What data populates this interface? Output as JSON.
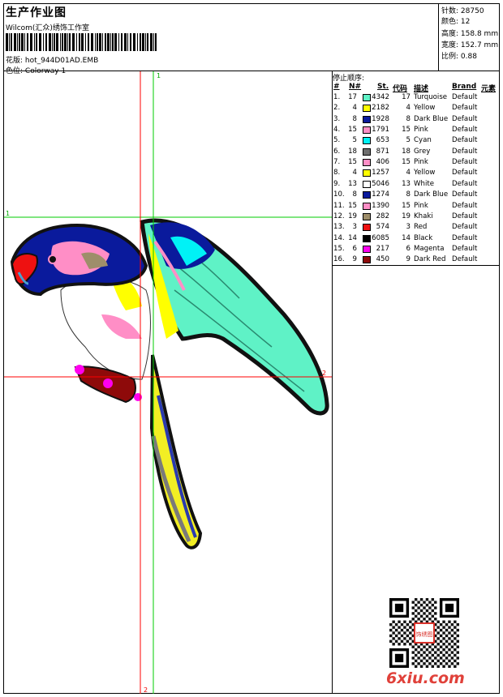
{
  "header": {
    "title": "生产作业图",
    "studio": "Wilcom(汇众)绣饰工作室",
    "design_label": "花版:",
    "design_file": "hot_944D01AD.EMB",
    "colorway_label": "色位:",
    "colorway": "Colorway 1"
  },
  "stats": [
    {
      "label": "针数:",
      "value": "28750"
    },
    {
      "label": "颜色:",
      "value": "12"
    },
    {
      "label": "高度:",
      "value": "158.8 mm"
    },
    {
      "label": "宽度:",
      "value": "152.7 mm"
    },
    {
      "label": "比例:",
      "value": "0.88"
    }
  ],
  "sequence": {
    "title": "停止顺序:",
    "columns": [
      "#",
      "N#",
      "St.",
      "代码",
      "描述",
      "Brand",
      "元素"
    ],
    "rows": [
      {
        "idx": "1.",
        "n": "17",
        "color": "#5ff2c6",
        "st": "4342",
        "code": "17",
        "desc": "Turquoise",
        "brand": "Default"
      },
      {
        "idx": "2.",
        "n": "4",
        "color": "#ffff00",
        "st": "2182",
        "code": "4",
        "desc": "Yellow",
        "brand": "Default"
      },
      {
        "idx": "3.",
        "n": "8",
        "color": "#0a1a9c",
        "st": "1928",
        "code": "8",
        "desc": "Dark Blue",
        "brand": "Default"
      },
      {
        "idx": "4.",
        "n": "15",
        "color": "#ff8ec6",
        "st": "1791",
        "code": "15",
        "desc": "Pink",
        "brand": "Default"
      },
      {
        "idx": "5.",
        "n": "5",
        "color": "#00f2f6",
        "st": "653",
        "code": "5",
        "desc": "Cyan",
        "brand": "Default"
      },
      {
        "idx": "6.",
        "n": "18",
        "color": "#6e6e6e",
        "st": "871",
        "code": "18",
        "desc": "Grey",
        "brand": "Default"
      },
      {
        "idx": "7.",
        "n": "15",
        "color": "#ff8ec6",
        "st": "406",
        "code": "15",
        "desc": "Pink",
        "brand": "Default"
      },
      {
        "idx": "8.",
        "n": "4",
        "color": "#ffff00",
        "st": "1257",
        "code": "4",
        "desc": "Yellow",
        "brand": "Default"
      },
      {
        "idx": "9.",
        "n": "13",
        "color": "#ffffff",
        "st": "5046",
        "code": "13",
        "desc": "White",
        "brand": "Default"
      },
      {
        "idx": "10.",
        "n": "8",
        "color": "#0a1a9c",
        "st": "1274",
        "code": "8",
        "desc": "Dark Blue",
        "brand": "Default"
      },
      {
        "idx": "11.",
        "n": "15",
        "color": "#ff8ec6",
        "st": "1390",
        "code": "15",
        "desc": "Pink",
        "brand": "Default"
      },
      {
        "idx": "12.",
        "n": "19",
        "color": "#9e8e6a",
        "st": "282",
        "code": "19",
        "desc": "Khaki",
        "brand": "Default"
      },
      {
        "idx": "13.",
        "n": "3",
        "color": "#ee1111",
        "st": "574",
        "code": "3",
        "desc": "Red",
        "brand": "Default"
      },
      {
        "idx": "14.",
        "n": "14",
        "color": "#000000",
        "st": "6085",
        "code": "14",
        "desc": "Black",
        "brand": "Default"
      },
      {
        "idx": "15.",
        "n": "6",
        "color": "#ff00ee",
        "st": "217",
        "code": "6",
        "desc": "Magenta",
        "brand": "Default"
      },
      {
        "idx": "16.",
        "n": "9",
        "color": "#8e0a0a",
        "st": "450",
        "code": "9",
        "desc": "Dark Red",
        "brand": "Default"
      }
    ]
  },
  "guides": {
    "v1": "1",
    "h1": "1",
    "h2": "2",
    "v2": "2"
  },
  "watermark": {
    "logo_text": "6xiu.com",
    "seal_text": "饰绣图"
  },
  "colors": {
    "guide_green": "#00cc00",
    "guide_red": "#ff0000",
    "logo_red": "#e0413a"
  }
}
